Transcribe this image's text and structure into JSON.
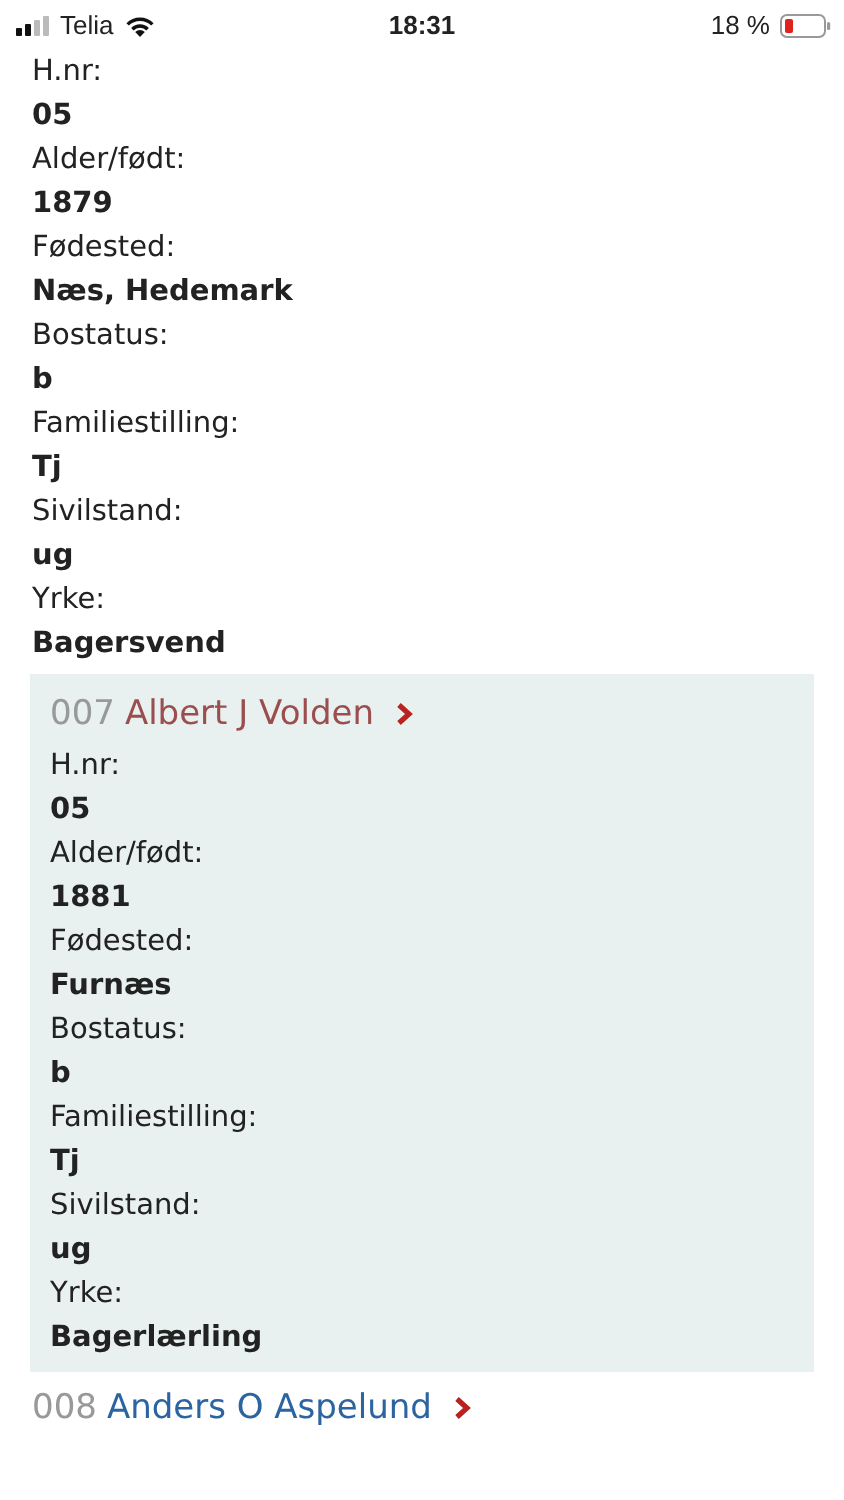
{
  "status_bar": {
    "carrier": "Telia",
    "time": "18:31",
    "battery": "18 %"
  },
  "records": [
    {
      "selected": false,
      "fields": [
        {
          "label": "H.nr:",
          "value": "05"
        },
        {
          "label": "Alder/født:",
          "value": "1879"
        },
        {
          "label": "Fødested:",
          "value": "Næs, Hedemark"
        },
        {
          "label": "Bostatus:",
          "value": "b"
        },
        {
          "label": "Familiestilling:",
          "value": "Tj"
        },
        {
          "label": "Sivilstand:",
          "value": "ug"
        },
        {
          "label": "Yrke:",
          "value": "Bagersvend"
        }
      ]
    },
    {
      "selected": true,
      "number": "007",
      "name": "Albert J Volden",
      "visited": true,
      "fields": [
        {
          "label": "H.nr:",
          "value": "05"
        },
        {
          "label": "Alder/født:",
          "value": "1881"
        },
        {
          "label": "Fødested:",
          "value": "Furnæs"
        },
        {
          "label": "Bostatus:",
          "value": "b"
        },
        {
          "label": "Familiestilling:",
          "value": "Tj"
        },
        {
          "label": "Sivilstand:",
          "value": "ug"
        },
        {
          "label": "Yrke:",
          "value": "Bagerlærling"
        }
      ]
    },
    {
      "selected": false,
      "number": "008",
      "name": "Anders O Aspelund",
      "visited": false
    }
  ]
}
